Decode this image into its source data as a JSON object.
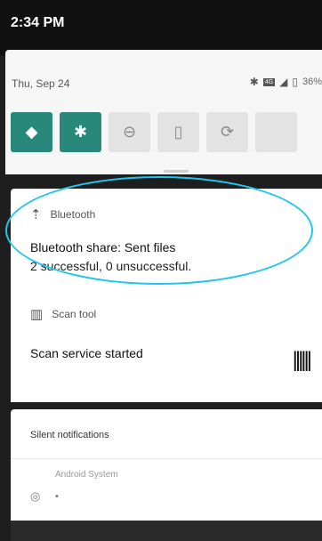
{
  "status_bar": {
    "time": "2:34 PM"
  },
  "quick_settings": {
    "date": "Thu, Sep 24",
    "network": "4G",
    "battery": "36%",
    "tiles": [
      {
        "icon": "wifi-icon",
        "active": true,
        "glyph": "◆",
        "badge": "?"
      },
      {
        "icon": "bluetooth-icon",
        "active": true,
        "glyph": "✱"
      },
      {
        "icon": "do-not-disturb-icon",
        "active": false,
        "glyph": "⊖"
      },
      {
        "icon": "flashlight-icon",
        "active": false,
        "glyph": "▯"
      },
      {
        "icon": "auto-rotate-icon",
        "active": false,
        "glyph": "⟳"
      },
      {
        "icon": "battery-saver-icon",
        "active": false,
        "glyph": ""
      }
    ]
  },
  "notifications": [
    {
      "app": "Bluetooth",
      "title": "Bluetooth share: Sent files",
      "body": "2 successful, 0 unsuccessful."
    },
    {
      "app": "Scan tool",
      "title": "Scan service started"
    }
  ],
  "silent": {
    "header": "Silent notifications",
    "item": "Android System",
    "dot": "•"
  },
  "colors": {
    "tile_active": "#28897a",
    "highlight": "#1ec6ee"
  }
}
